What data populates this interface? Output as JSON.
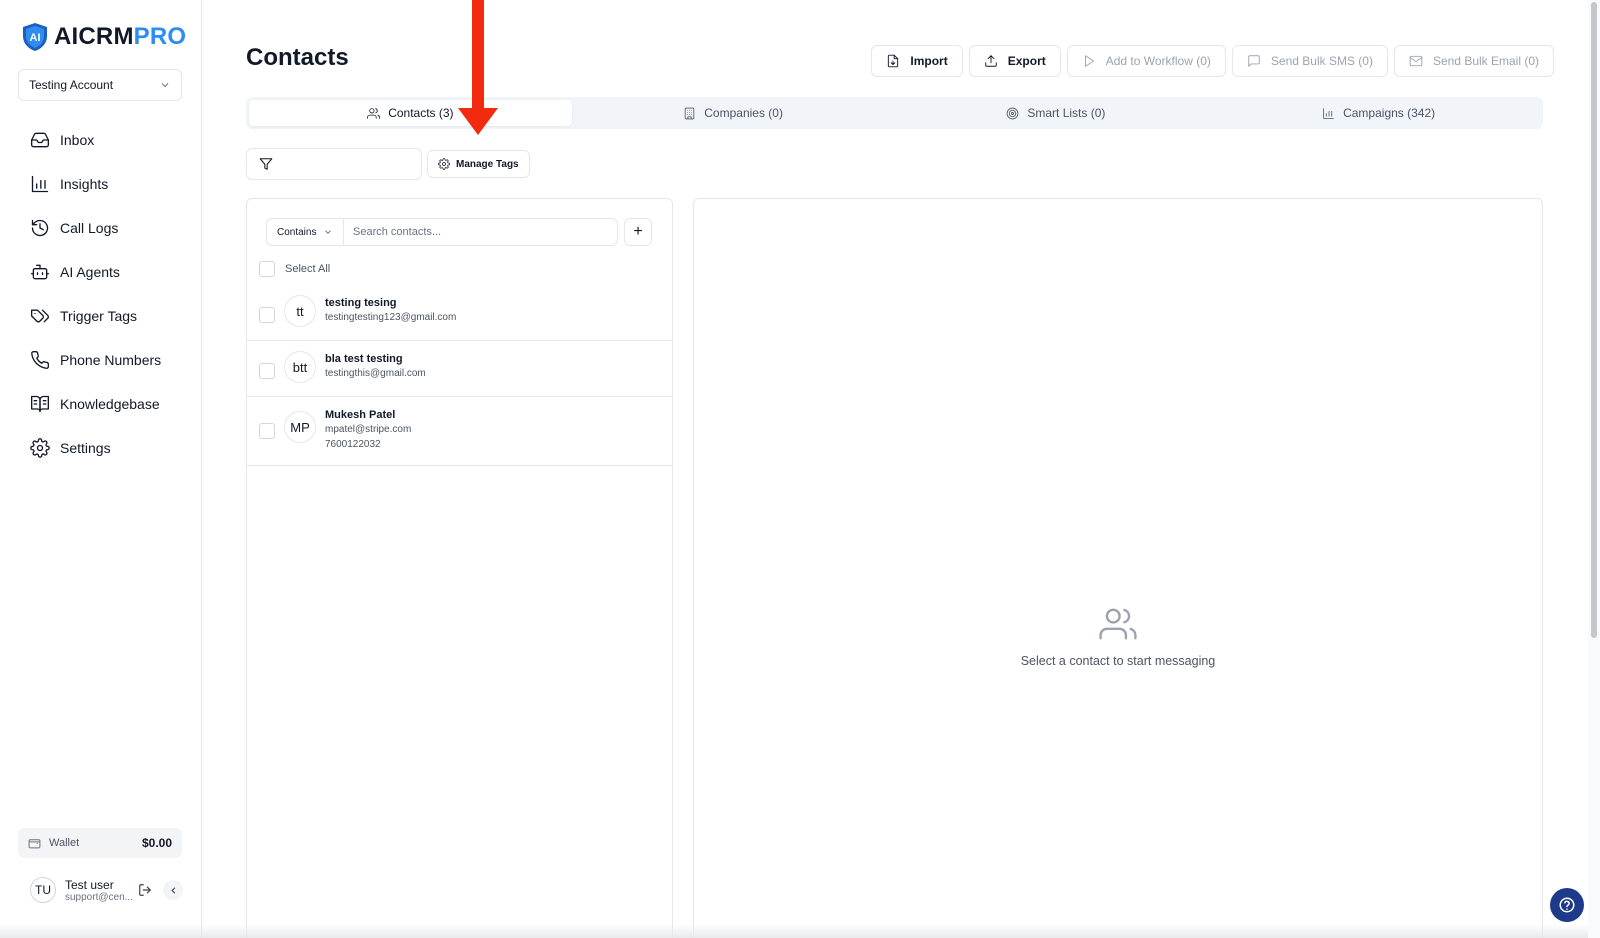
{
  "brand": {
    "part1": "AICRM",
    "part2": "PRO",
    "accent": "#2f8cf0"
  },
  "account": {
    "selected": "Testing Account"
  },
  "sidebar": {
    "items": [
      {
        "label": "Inbox",
        "icon": "inbox-icon"
      },
      {
        "label": "Insights",
        "icon": "bar-chart-icon"
      },
      {
        "label": "Call Logs",
        "icon": "history-icon"
      },
      {
        "label": "AI Agents",
        "icon": "bot-icon"
      },
      {
        "label": "Trigger Tags",
        "icon": "tags-icon"
      },
      {
        "label": "Phone Numbers",
        "icon": "phone-icon"
      },
      {
        "label": "Knowledgebase",
        "icon": "book-icon"
      },
      {
        "label": "Settings",
        "icon": "gear-icon"
      }
    ]
  },
  "wallet": {
    "label": "Wallet",
    "amount": "$0.00"
  },
  "user": {
    "initials": "TU",
    "name": "Test user",
    "email": "support@cen..."
  },
  "page": {
    "title": "Contacts"
  },
  "toolbar": {
    "import": "Import",
    "export": "Export",
    "workflow": "Add to Workflow (0)",
    "sms": "Send Bulk SMS (0)",
    "email": "Send Bulk Email (0)"
  },
  "tabs": [
    {
      "label": "Contacts (3)",
      "active": true
    },
    {
      "label": "Companies (0)",
      "active": false
    },
    {
      "label": "Smart Lists (0)",
      "active": false
    },
    {
      "label": "Campaigns (342)",
      "active": false
    }
  ],
  "filters": {
    "manage_tags": "Manage Tags"
  },
  "search": {
    "mode": "Contains",
    "placeholder": "Search contacts...",
    "value": "",
    "add": "+"
  },
  "list": {
    "select_all": "Select All",
    "contacts": [
      {
        "initials": "tt",
        "name": "testing tesing",
        "email": "testingtesting123@gmail.com",
        "phone": ""
      },
      {
        "initials": "btt",
        "name": "bla test testing",
        "email": "testingthis@gmail.com",
        "phone": ""
      },
      {
        "initials": "MP",
        "name": "Mukesh Patel",
        "email": "mpatel@stripe.com",
        "phone": "7600122032"
      }
    ]
  },
  "messaging": {
    "empty_text": "Select a contact to start messaging"
  },
  "colors": {
    "arrow": "#f22a10",
    "help_button": "#1e3a8a"
  }
}
